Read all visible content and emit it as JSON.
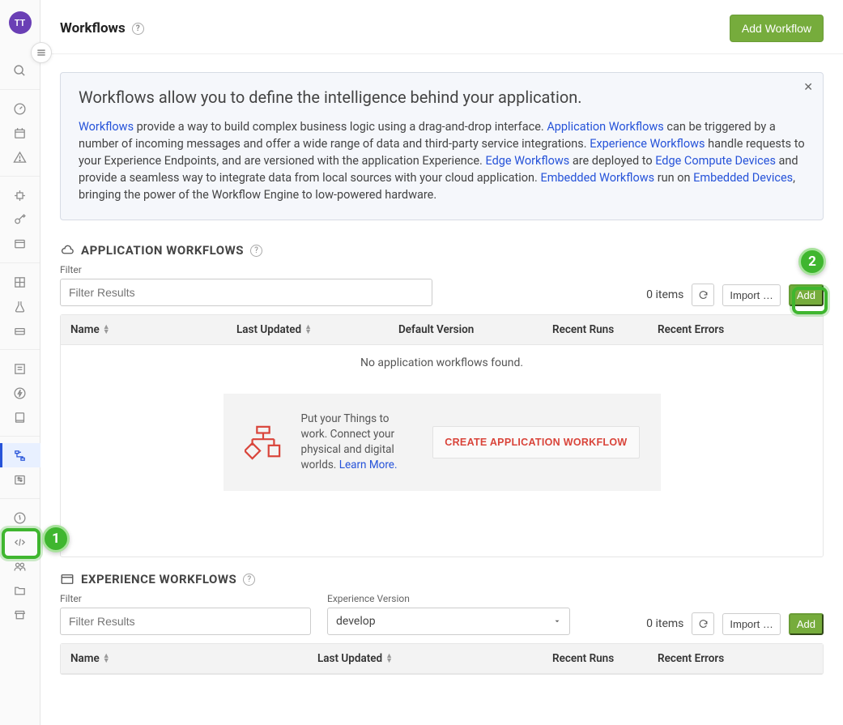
{
  "avatar": "TT",
  "header": {
    "title": "Workflows",
    "add_btn": "Add Workflow"
  },
  "info": {
    "title": "Workflows allow you to define the intelligence behind your application.",
    "link_workflows": "Workflows",
    "t1": " provide a way to build complex business logic using a drag-and-drop interface. ",
    "link_app_wf": "Application Workflows",
    "t2": " can be triggered by a number of incoming messages and offer a wide range of data and third-party service integrations. ",
    "link_exp_wf": "Experience Workflows",
    "t3": " handle requests to your Experience Endpoints, and are versioned with the application Experience. ",
    "link_edge_wf": "Edge Workflows",
    "t4": " are deployed to ",
    "link_edge_dev": "Edge Compute Devices",
    "t5": " and provide a seamless way to integrate data from local sources with your cloud application. ",
    "link_emb_wf": "Embedded Workflows",
    "t6": " run on ",
    "link_emb_dev": "Embedded Devices",
    "t7": ", bringing the power of the Workflow Engine to low-powered hardware."
  },
  "app_section": {
    "title": "APPLICATION WORKFLOWS",
    "filter_label": "Filter",
    "filter_placeholder": "Filter Results",
    "items_text": "0 items",
    "import_btn": "Import …",
    "add_btn": "Add",
    "cols": {
      "name": "Name",
      "last_updated": "Last Updated",
      "default_version": "Default Version",
      "recent_runs": "Recent Runs",
      "recent_errors": "Recent Errors"
    },
    "empty": "No application workflows found.",
    "cta_text1": "Put your Things to work. Connect your physical and digital worlds. ",
    "cta_learn": "Learn More.",
    "cta_btn": "CREATE APPLICATION WORKFLOW"
  },
  "exp_section": {
    "title": "EXPERIENCE WORKFLOWS",
    "filter_label": "Filter",
    "filter_placeholder": "Filter Results",
    "version_label": "Experience Version",
    "version_value": "develop",
    "items_text": "0 items",
    "import_btn": "Import …",
    "add_btn": "Add",
    "cols": {
      "name": "Name",
      "last_updated": "Last Updated",
      "recent_runs": "Recent Runs",
      "recent_errors": "Recent Errors"
    }
  },
  "callouts": {
    "one": "1",
    "two": "2"
  }
}
